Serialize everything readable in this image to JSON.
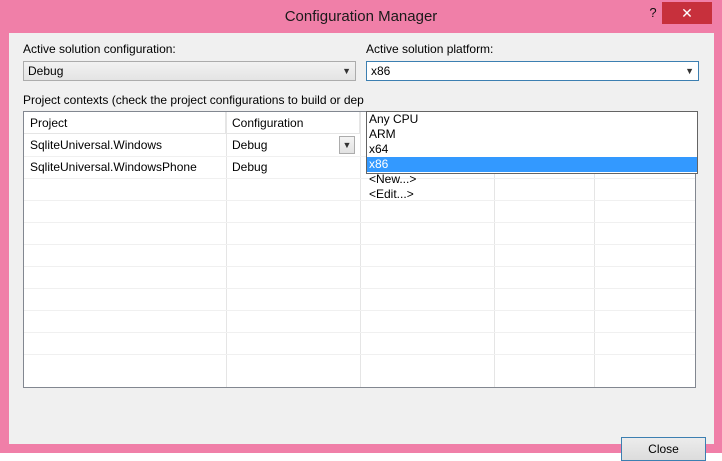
{
  "window": {
    "title": "Configuration Manager",
    "help_glyph": "?",
    "close_glyph": "✕"
  },
  "active_config": {
    "label": "Active solution configuration:",
    "value": "Debug"
  },
  "active_platform": {
    "label": "Active solution platform:",
    "value": "x86",
    "options": [
      "Any CPU",
      "ARM",
      "x64",
      "x86",
      "<New...>",
      "<Edit...>"
    ],
    "selected_index": 3
  },
  "contexts": {
    "label": "Project contexts (check the project configurations to build or dep",
    "columns": [
      "Project",
      "Configuration"
    ],
    "rows": [
      {
        "project": "SqliteUniversal.Windows",
        "configuration": "Debug"
      },
      {
        "project": "SqliteUniversal.WindowsPhone",
        "configuration": "Debug"
      }
    ]
  },
  "footer": {
    "close_label": "Close"
  },
  "colors": {
    "window_frame": "#f07fa8",
    "close_button": "#c7303c",
    "selection": "#3399ff"
  }
}
